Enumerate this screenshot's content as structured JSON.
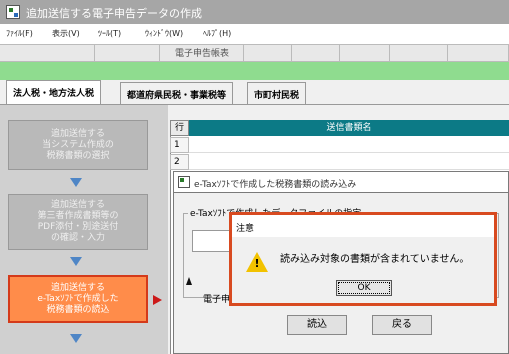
{
  "window": {
    "title": "追加送信する電子申告データの作成"
  },
  "menu": [
    {
      "label": "ﾌｧｲﾙ(F)"
    },
    {
      "label": "表示(V)"
    },
    {
      "label": "ﾂｰﾙ(T)"
    },
    {
      "label": "ｳｨﾝﾄﾞｳ(W)"
    },
    {
      "label": "ﾍﾙﾌﾟ(H)"
    }
  ],
  "ribbon": {
    "label": "電子申告帳表"
  },
  "tabs": [
    {
      "label": "法人税・地方法人税",
      "active": true
    },
    {
      "label": "都道府県民税・事業税等",
      "active": false
    },
    {
      "label": "市町村民税",
      "active": false
    }
  ],
  "steps": [
    {
      "label": "追加送信する\n当システム作成の\n税務書類の選択"
    },
    {
      "label": "追加送信する\n第三者作成書類等の\nPDF添付・別途送付\nの確認・入力"
    },
    {
      "label": "追加送信する\ne-Taxｿﾌﾄで作成した\n税務書類の読込"
    }
  ],
  "grid": {
    "col_num": "行",
    "col_name": "送信書類名",
    "rows": [
      "1",
      "2"
    ]
  },
  "load_dialog": {
    "title": "e-Taxｿﾌﾄで作成した税務書類の読み込み",
    "group_label": "e-Taxｿﾌﾄで作成したデータファイルの指定",
    "electronic_text": "電子申",
    "load_button": "読込",
    "back_button": "戻る"
  },
  "alert": {
    "title": "注意",
    "message": "読み込み対象の書類が含まれていません。",
    "ok_button": "OK"
  },
  "colors": {
    "accent_green": "#8fdc8f",
    "header_teal": "#0c7a86",
    "active_step": "#ff8c4a",
    "highlight_border": "#d84a20"
  }
}
